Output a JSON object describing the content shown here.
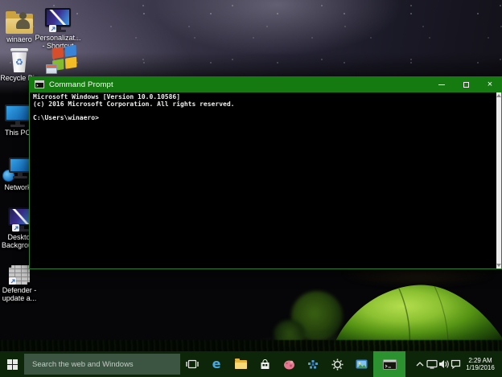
{
  "desktop": {
    "icons": [
      {
        "name": "winaero-folder",
        "label": "winaero"
      },
      {
        "name": "personalization-shortcut",
        "label_line1": "Personalizat...",
        "label_line2": "- Shortcut"
      },
      {
        "name": "recycle-bin",
        "label": "Recycle Bin"
      },
      {
        "name": "windows-app"
      },
      {
        "name": "this-pc",
        "label": "This PC"
      },
      {
        "name": "network",
        "label": "Network"
      },
      {
        "name": "desktop-background-shortcut",
        "label_line1": "Desktop",
        "label_line2": "Background"
      },
      {
        "name": "defender-shortcut",
        "label_line1": "Defender -",
        "label_line2": "update a..."
      }
    ]
  },
  "window": {
    "title": "Command Prompt",
    "console_lines": [
      "Microsoft Windows [Version 10.0.10586]",
      "(c) 2016 Microsoft Corporation. All rights reserved.",
      "",
      "C:\\Users\\winaero>"
    ]
  },
  "taskbar": {
    "search_placeholder": "Search the web and Windows",
    "icons": [
      "start",
      "task-view",
      "edge",
      "file-explorer",
      "store",
      "winaero-app",
      "pixel-app",
      "settings",
      "display-photos",
      "command-prompt"
    ],
    "tray_icons": [
      "hidden-icons-chevron",
      "network",
      "volume",
      "action-center"
    ],
    "clock_time": "2:29 AM",
    "clock_date": "1/19/2016"
  },
  "icons_glyphs": {
    "edge_glyph": "e",
    "close_glyph": "×",
    "recycle_glyph": "♻"
  },
  "colors": {
    "titlebar_green": "#157a10",
    "window_border_green": "#2e7d2e",
    "taskbar_green": "#0d2508",
    "search_box_green": "#3c5543",
    "active_task_green": "#2c9230",
    "console_bg": "#000000",
    "console_text": "#efefef"
  }
}
